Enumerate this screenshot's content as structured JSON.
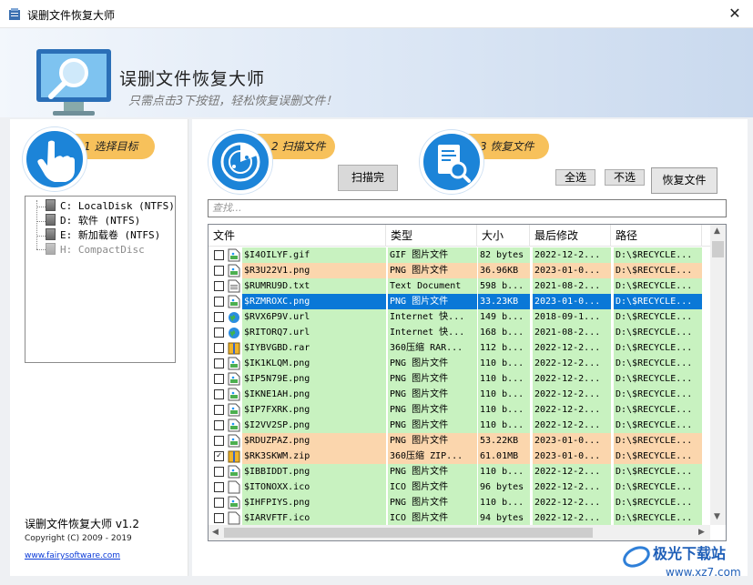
{
  "window": {
    "title": "误删文件恢复大师",
    "close": "✕"
  },
  "header": {
    "title": "误删文件恢复大师",
    "slogan": "只需点击3下按钮，轻松恢复误删文件！"
  },
  "steps": [
    {
      "label": "1 选择目标"
    },
    {
      "label": "2 扫描文件"
    },
    {
      "label": "3 恢复文件"
    }
  ],
  "drives": [
    {
      "label": "C: LocalDisk (NTFS)",
      "enabled": true
    },
    {
      "label": "D: 软件 (NTFS)",
      "enabled": true
    },
    {
      "label": "E: 新加载卷 (NTFS)",
      "enabled": true
    },
    {
      "label": "H: CompactDisc",
      "enabled": false
    }
  ],
  "buttons": {
    "scan": "扫描完",
    "select_all": "全选",
    "select_none": "不选",
    "recover": "恢复文件"
  },
  "search": {
    "placeholder": "查找..."
  },
  "columns": [
    "文件",
    "类型",
    "大小",
    "最后修改",
    "路径"
  ],
  "rows": [
    {
      "name": "$I4OILYF.gif",
      "type": "GIF 图片文件",
      "size": "82 bytes",
      "modified": "2022-12-2...",
      "path": "D:\\$RECYCLE...",
      "checked": false,
      "color": "#c8f2c0",
      "icon": "image"
    },
    {
      "name": "$R3U22V1.png",
      "type": "PNG 图片文件",
      "size": "36.96KB",
      "modified": "2023-01-0...",
      "path": "D:\\$RECYCLE...",
      "checked": false,
      "color": "#fbd6ad",
      "icon": "image"
    },
    {
      "name": "$RUMRU9D.txt",
      "type": "Text Document",
      "size": "598 b...",
      "modified": "2021-08-2...",
      "path": "D:\\$RECYCLE...",
      "checked": false,
      "color": "#c8f2c0",
      "icon": "text"
    },
    {
      "name": "$RZMROXC.png",
      "type": "PNG 图片文件",
      "size": "33.23KB",
      "modified": "2023-01-0...",
      "path": "D:\\$RECYCLE...",
      "checked": false,
      "color": "#0a78d7",
      "icon": "image",
      "selected": true
    },
    {
      "name": "$RVX6P9V.url",
      "type": "Internet 快...",
      "size": "149 b...",
      "modified": "2018-09-1...",
      "path": "D:\\$RECYCLE...",
      "checked": false,
      "color": "#c8f2c0",
      "icon": "globe"
    },
    {
      "name": "$RITORQ7.url",
      "type": "Internet 快...",
      "size": "168 b...",
      "modified": "2021-08-2...",
      "path": "D:\\$RECYCLE...",
      "checked": false,
      "color": "#c8f2c0",
      "icon": "globe"
    },
    {
      "name": "$IYBVGBD.rar",
      "type": "360压缩 RAR...",
      "size": "112 b...",
      "modified": "2022-12-2...",
      "path": "D:\\$RECYCLE...",
      "checked": false,
      "color": "#c8f2c0",
      "icon": "archive"
    },
    {
      "name": "$IK1KLQM.png",
      "type": "PNG 图片文件",
      "size": "110 b...",
      "modified": "2022-12-2...",
      "path": "D:\\$RECYCLE...",
      "checked": false,
      "color": "#c8f2c0",
      "icon": "image"
    },
    {
      "name": "$IP5N79E.png",
      "type": "PNG 图片文件",
      "size": "110 b...",
      "modified": "2022-12-2...",
      "path": "D:\\$RECYCLE...",
      "checked": false,
      "color": "#c8f2c0",
      "icon": "image"
    },
    {
      "name": "$IKNE1AH.png",
      "type": "PNG 图片文件",
      "size": "110 b...",
      "modified": "2022-12-2...",
      "path": "D:\\$RECYCLE...",
      "checked": false,
      "color": "#c8f2c0",
      "icon": "image"
    },
    {
      "name": "$IP7FXRK.png",
      "type": "PNG 图片文件",
      "size": "110 b...",
      "modified": "2022-12-2...",
      "path": "D:\\$RECYCLE...",
      "checked": false,
      "color": "#c8f2c0",
      "icon": "image"
    },
    {
      "name": "$I2VV2SP.png",
      "type": "PNG 图片文件",
      "size": "110 b...",
      "modified": "2022-12-2...",
      "path": "D:\\$RECYCLE...",
      "checked": false,
      "color": "#c8f2c0",
      "icon": "image"
    },
    {
      "name": "$RDUZPAZ.png",
      "type": "PNG 图片文件",
      "size": "53.22KB",
      "modified": "2023-01-0...",
      "path": "D:\\$RECYCLE...",
      "checked": false,
      "color": "#fbd6ad",
      "icon": "image"
    },
    {
      "name": "$RK3SKWM.zip",
      "type": "360压缩 ZIP...",
      "size": "61.01MB",
      "modified": "2023-01-0...",
      "path": "D:\\$RECYCLE...",
      "checked": true,
      "color": "#fbd6ad",
      "icon": "archive"
    },
    {
      "name": "$IBBIDDT.png",
      "type": "PNG 图片文件",
      "size": "110 b...",
      "modified": "2022-12-2...",
      "path": "D:\\$RECYCLE...",
      "checked": false,
      "color": "#c8f2c0",
      "icon": "image"
    },
    {
      "name": "$ITONOXX.ico",
      "type": "ICO 图片文件",
      "size": "96 bytes",
      "modified": "2022-12-2...",
      "path": "D:\\$RECYCLE...",
      "checked": false,
      "color": "#c8f2c0",
      "icon": "blank"
    },
    {
      "name": "$IHFPIYS.png",
      "type": "PNG 图片文件",
      "size": "110 b...",
      "modified": "2022-12-2...",
      "path": "D:\\$RECYCLE...",
      "checked": false,
      "color": "#c8f2c0",
      "icon": "image"
    },
    {
      "name": "$IARVFTF.ico",
      "type": "ICO 图片文件",
      "size": "94 bytes",
      "modified": "2022-12-2...",
      "path": "D:\\$RECYCLE...",
      "checked": false,
      "color": "#c8f2c0",
      "icon": "blank"
    }
  ],
  "footer": {
    "name": "误删文件恢复大师 v1.2",
    "copyright": "Copyright (C) 2009 - 2019",
    "link": "www.fairysoftware.com"
  },
  "watermark": {
    "brand": "极光下载站",
    "url": "www.xz7.com"
  }
}
